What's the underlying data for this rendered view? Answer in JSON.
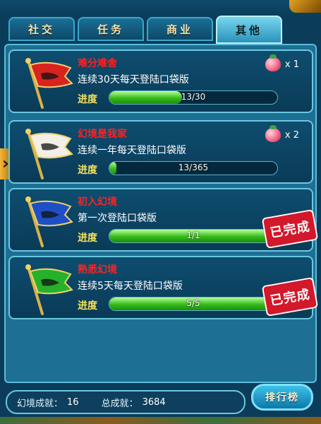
{
  "tabs": [
    {
      "label": "社交",
      "active": false
    },
    {
      "label": "任务",
      "active": false
    },
    {
      "label": "商业",
      "active": false
    },
    {
      "label": "其他",
      "active": true
    }
  ],
  "progress_label": "进度",
  "achievements": [
    {
      "title": "难分难舍",
      "desc": "连续30天每天登陆口袋版",
      "progress_text": "13/30",
      "progress": 0.433,
      "reward": {
        "icon": "peach-icon",
        "count": "x 1"
      },
      "completed": false,
      "flag_color": "#d8231f"
    },
    {
      "title": "幻境是我家",
      "desc": "连续一年每天登陆口袋版",
      "progress_text": "13/365",
      "progress": 0.036,
      "reward": {
        "icon": "peach-icon",
        "count": "x 2"
      },
      "completed": false,
      "flag_color": "#f2f0e6"
    },
    {
      "title": "初入幻境",
      "desc": "第一次登陆口袋版",
      "progress_text": "1/1",
      "progress": 1.0,
      "completed": true,
      "stamp_text": "已完成",
      "flag_color": "#1f4fc7"
    },
    {
      "title": "熟悉幻境",
      "desc": "连续5天每天登陆口袋版",
      "progress_text": "5/5",
      "progress": 1.0,
      "completed": true,
      "stamp_text": "已完成",
      "flag_color": "#26b12a"
    }
  ],
  "footer": {
    "fantasy_label": "幻境成就：",
    "fantasy_value": "16",
    "total_label": "总成就：",
    "total_value": "3684",
    "rank_button": "排行榜"
  }
}
